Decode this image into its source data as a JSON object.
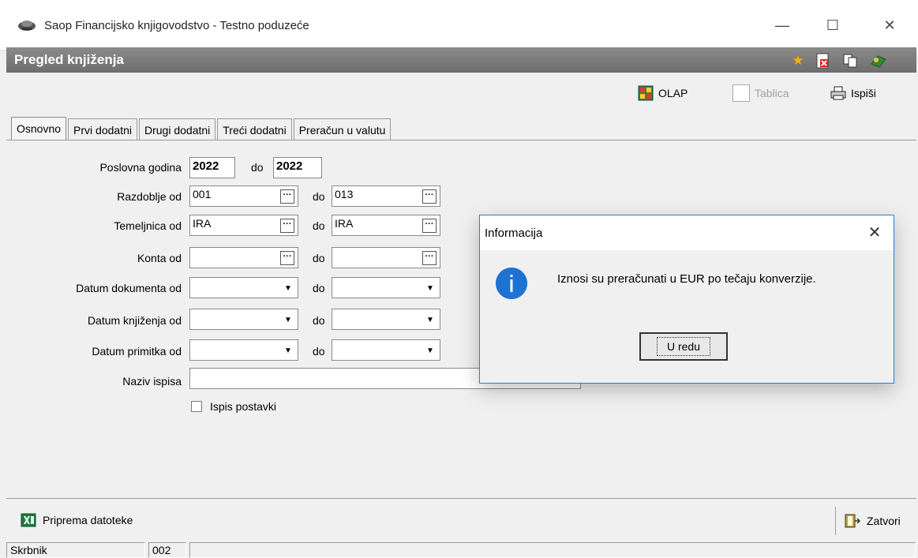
{
  "window": {
    "title": "Saop Financijsko knjigovodstvo - Testno poduzeće",
    "minimize_label": "—",
    "maximize_label": "☐",
    "close_label": "✕"
  },
  "form": {
    "title": "Pregled knjiženja"
  },
  "toolbar": {
    "olap_label": "OLAP",
    "tablica_label": "Tablica",
    "ispisi_label": "Ispiši"
  },
  "tabs": [
    {
      "label": "Osnovno"
    },
    {
      "label": "Prvi dodatni"
    },
    {
      "label": "Drugi dodatni"
    },
    {
      "label": "Treći dodatni"
    },
    {
      "label": "Preračun u valutu"
    }
  ],
  "fields": {
    "poslovna_godina_label": "Poslovna godina",
    "poslovna_godina_od": "2022",
    "poslovna_godina_do": "2022",
    "razdoblje_label": "Razdoblje od",
    "razdoblje_od": "001",
    "razdoblje_do": "013",
    "temeljnica_label": "Temeljnica od",
    "temeljnica_od": "IRA",
    "temeljnica_do": "IRA",
    "konta_label": "Konta od",
    "konta_od": "",
    "konta_do": "",
    "datum_dokumenta_label": "Datum dokumenta od",
    "datum_knjizenja_label": "Datum knjiženja od",
    "datum_primitka_label": "Datum primitka od",
    "naziv_ispisa_label": "Naziv ispisa",
    "naziv_ispisa": "",
    "ispis_postavki_label": "Ispis postavki",
    "do_label": "do",
    "ellipsis": "···",
    "dropdown_glyph": "▼"
  },
  "bottom": {
    "priprema_label": "Priprema datoteke",
    "zatvori_label": "Zatvori"
  },
  "status": {
    "user": "Skrbnik",
    "code": "002"
  },
  "dialog": {
    "title": "Informacija",
    "message": "Iznosi su preračunati u EUR po tečaju konverzije.",
    "ok_label": "U redu",
    "close_label": "✕",
    "icon_glyph": "i"
  }
}
